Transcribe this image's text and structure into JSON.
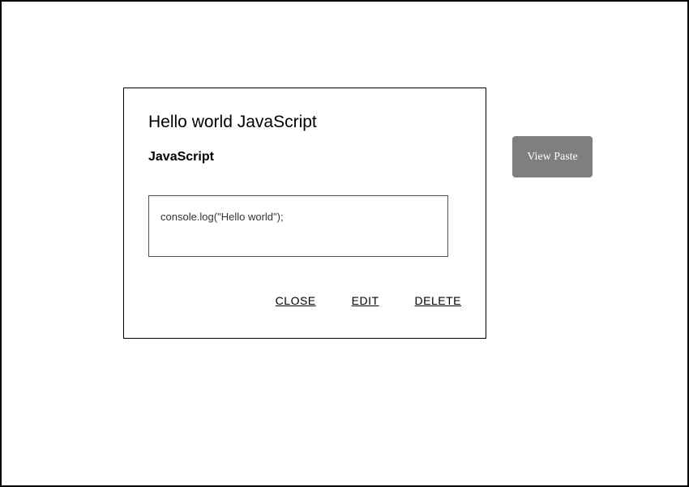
{
  "modal": {
    "title": "Hello world JavaScript",
    "subtitle": "JavaScript",
    "code": "console.log(\"Hello world\");",
    "actions": {
      "close": "CLOSE",
      "edit": "EDIT",
      "delete": "DELETE"
    }
  },
  "sidebar": {
    "view_paste_label": "View Paste"
  }
}
